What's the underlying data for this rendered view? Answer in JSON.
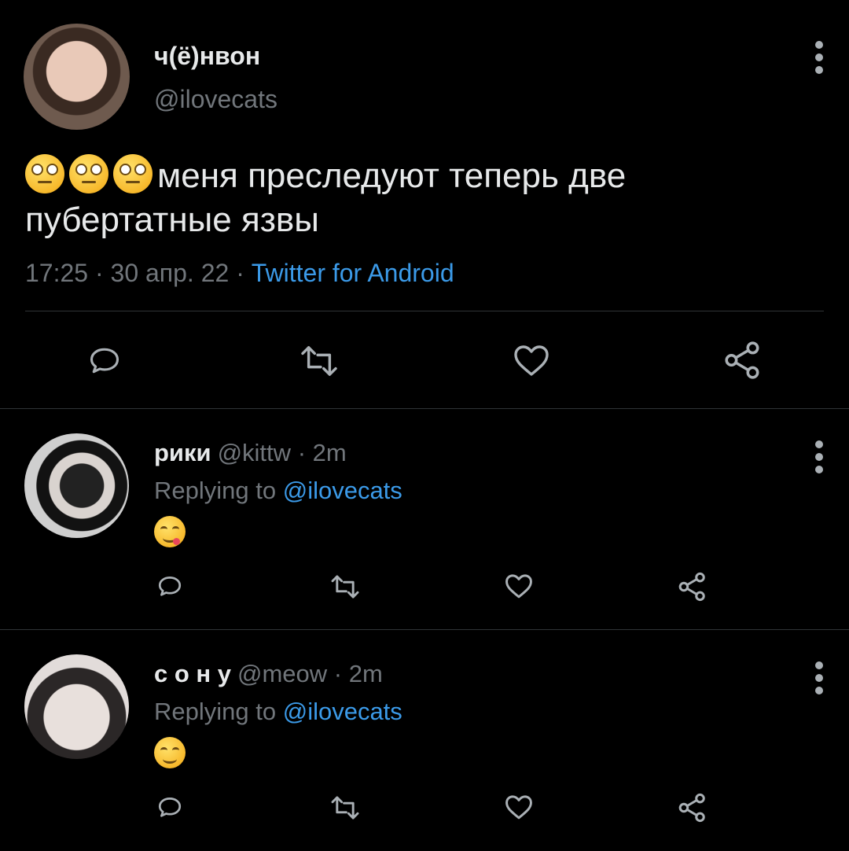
{
  "tweet": {
    "author_name": "ч(ё)нвон",
    "author_handle": "@ilovecats",
    "text": "меня преследуют теперь две пубертатные язвы",
    "emoji_prefix": [
      "face-with-rolling-eyes",
      "face-with-rolling-eyes",
      "face-with-rolling-eyes"
    ],
    "time": "17:25",
    "date": "30 апр. 22",
    "separator": "·",
    "source": "Twitter for Android",
    "actions": [
      "reply-icon",
      "retweet-icon",
      "like-icon",
      "share-icon"
    ]
  },
  "replies": [
    {
      "name": "рики",
      "handle": "@kittw",
      "age": "2m",
      "replying_label": "Replying to",
      "replying_handle": "@ilovecats",
      "emoji": "face-savoring-food"
    },
    {
      "name": "с о н у",
      "handle": "@meow",
      "age": "2m",
      "replying_label": "Replying to",
      "replying_handle": "@ilovecats",
      "emoji": "smiling-face-with-smiling-eyes"
    }
  ],
  "colors": {
    "background": "#000000",
    "text_primary": "#e7e9ea",
    "text_secondary": "#71767b",
    "link": "#3b9ae8",
    "divider": "#2f3336"
  }
}
